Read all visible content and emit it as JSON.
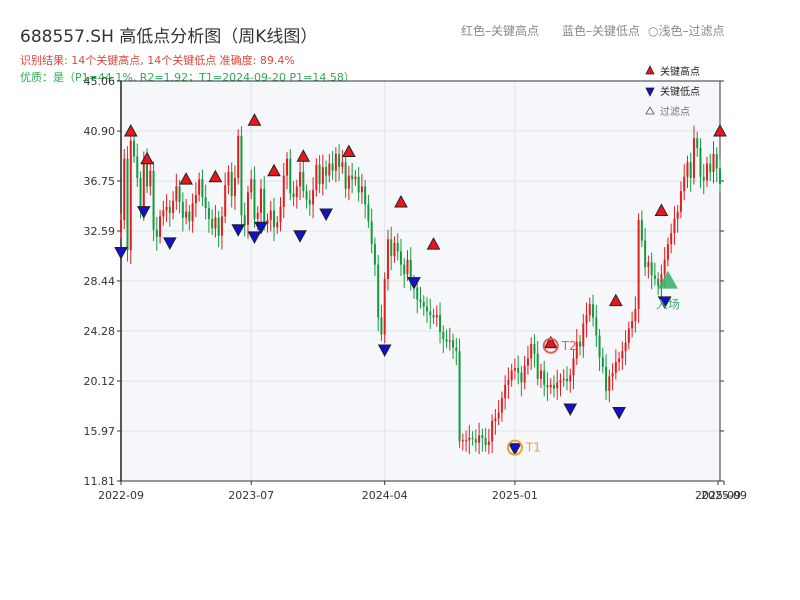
{
  "header": {
    "title": "688557.SH 高低点分析图（周K线图）",
    "legend_red": "红色–关键高点",
    "legend_blue": "蓝色–关键低点",
    "legend_light": "○浅色–过滤点",
    "result_line": "识别结果: 14个关键高点, 14个关键低点  准确度: 89.4%",
    "quality_line": "优质：是（P1=44.1%, R2=1.92；T1=2024-09-20 P1=14.58）"
  },
  "legend": {
    "high": "关键高点",
    "low": "关键低点",
    "filter": "过滤点"
  },
  "colors": {
    "up": "#e21d1d",
    "down": "#139a3c",
    "high_marker": "#e8171b",
    "low_marker": "#1111cc",
    "t1": "#f0a030",
    "t2": "#e85a5a",
    "entry": "#3cb371",
    "plot_bg": "#f5f7fa",
    "grid": "#dfe3e8"
  },
  "chart_data": {
    "type": "candlestick",
    "ylim": [
      11.81,
      45.06
    ],
    "yticks": [
      "11.81",
      "15.97",
      "20.12",
      "24.28",
      "28.44",
      "32.59",
      "36.75",
      "40.90",
      "45.06"
    ],
    "xticks": [
      "2022-09",
      "2023-07",
      "2024-04",
      "2025-01",
      "2025-09",
      "2025-09"
    ],
    "prices": [
      33.5,
      38.6,
      31.0,
      40.1,
      38.8,
      37.0,
      34.6,
      38.4,
      36.3,
      37.6,
      32.7,
      32.1,
      33.8,
      34.3,
      34.6,
      34.1,
      35.1,
      36.3,
      35.0,
      33.7,
      34.2,
      33.4,
      34.9,
      35.6,
      36.9,
      35.4,
      34.5,
      33.6,
      32.8,
      33.7,
      32.2,
      33.8,
      36.4,
      37.5,
      35.5,
      37.0,
      40.5,
      33.9,
      33.1,
      35.8,
      36.9,
      33.6,
      34.1,
      36.1,
      33.2,
      33.5,
      34.3,
      32.9,
      33.3,
      34.6,
      37.2,
      38.6,
      35.7,
      35.4,
      36.3,
      37.5,
      35.9,
      35.2,
      34.8,
      36.0,
      38.1,
      36.5,
      37.9,
      37.2,
      38.2,
      37.6,
      39.0,
      37.9,
      38.3,
      36.1,
      37.2,
      36.9,
      37.1,
      35.8,
      36.3,
      34.8,
      33.4,
      31.5,
      29.8,
      25.4,
      24.0,
      28.6,
      31.9,
      30.5,
      31.6,
      30.9,
      29.8,
      29.0,
      30.2,
      28.4,
      27.9,
      26.9,
      26.7,
      26.3,
      25.9,
      25.6,
      25.4,
      25.6,
      24.2,
      23.6,
      23.4,
      23.5,
      22.9,
      22.6,
      15.1,
      15.2,
      15.2,
      15.4,
      15.3,
      15.0,
      15.6,
      15.4,
      14.8,
      15.1,
      16.8,
      17.0,
      17.5,
      18.7,
      19.8,
      20.2,
      21.0,
      21.2,
      20.8,
      20.0,
      21.4,
      22.0,
      23.2,
      22.4,
      20.3,
      21.0,
      19.8,
      19.6,
      19.8,
      19.5,
      20.0,
      20.2,
      20.3,
      20.1,
      20.6,
      22.0,
      23.4,
      23.0,
      24.9,
      25.6,
      26.5,
      25.4,
      23.9,
      22.1,
      21.3,
      19.3,
      20.5,
      20.8,
      21.7,
      22.0,
      22.6,
      23.3,
      24.5,
      25.1,
      26.1,
      33.5,
      31.8,
      29.6,
      30.0,
      28.9,
      28.6,
      28.0,
      29.0,
      30.2,
      31.5,
      32.4,
      33.6,
      34.2,
      35.9,
      37.1,
      38.3,
      37.0,
      40.3,
      39.5,
      37.1,
      36.8,
      38.2,
      37.5,
      39.0,
      37.8,
      36.5
    ],
    "key_highs": [
      {
        "x": "2022-09",
        "value": 40.9
      },
      {
        "x": "2022-10",
        "value": 38.6
      },
      {
        "x": "2023-01",
        "value": 36.9
      },
      {
        "x": "2023-03",
        "value": 37.1
      },
      {
        "x": "2023-05",
        "value": 41.8
      },
      {
        "x": "2023-07",
        "value": 37.6
      },
      {
        "x": "2023-09",
        "value": 38.8
      },
      {
        "x": "2023-11",
        "value": 39.2
      },
      {
        "x": "2024-02",
        "value": 35.0
      },
      {
        "x": "2024-03",
        "value": 31.5
      },
      {
        "x": "2024-12",
        "value": 23.3
      },
      {
        "x": "2025-04",
        "value": 26.8
      },
      {
        "x": "2025-06",
        "value": 34.3
      },
      {
        "x": "2025-09",
        "value": 40.9
      }
    ],
    "key_lows": [
      {
        "x": "2022-08",
        "value": 30.8
      },
      {
        "x": "2022-10",
        "value": 34.2
      },
      {
        "x": "2022-12",
        "value": 31.6
      },
      {
        "x": "2023-03",
        "value": 32.7
      },
      {
        "x": "2023-05",
        "value": 32.1
      },
      {
        "x": "2023-06",
        "value": 32.9
      },
      {
        "x": "2023-08",
        "value": 32.2
      },
      {
        "x": "2023-10",
        "value": 34.0
      },
      {
        "x": "2024-02",
        "value": 22.7
      },
      {
        "x": "2024-03",
        "value": 28.3
      },
      {
        "x": "2024-09",
        "value": 14.5
      },
      {
        "x": "2025-01",
        "value": 17.8
      },
      {
        "x": "2025-05",
        "value": 17.5
      },
      {
        "x": "2025-07",
        "value": 26.7
      }
    ],
    "t1": {
      "label": "T1",
      "x": "2024-09-20",
      "value": 14.58
    },
    "t2": {
      "label": "T2",
      "x": "2024-12",
      "value": 23.3
    },
    "entry": {
      "label": "入场",
      "x": "2025-06",
      "value": 28.3
    }
  }
}
